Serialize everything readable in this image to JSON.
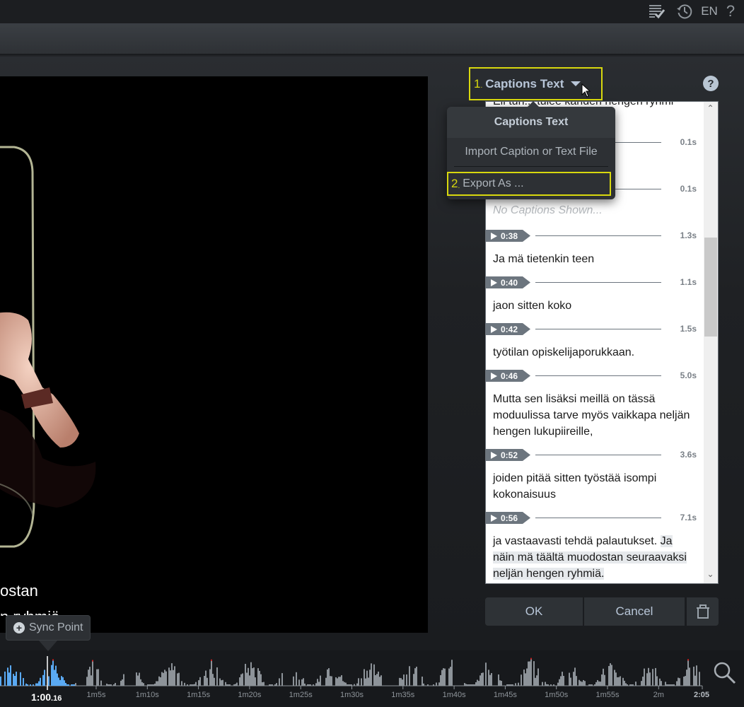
{
  "topbar": {
    "icons": [
      "checklist-icon",
      "history-icon"
    ],
    "language": "EN",
    "help_glyph": "?"
  },
  "video_overlay": {
    "caption_line1": "ostan",
    "caption_line2": "n ryhmiä"
  },
  "caption_panel": {
    "step1_number": "1",
    "selector_label": "Captions Text",
    "help_glyph": "?",
    "clipped_top_text": "Eli tuh... tulee kahden hengen ryhmi",
    "placeholder": "No Captions Shown...",
    "entries": [
      {
        "time": "",
        "duration": "0.1s",
        "text": ""
      },
      {
        "time": "",
        "duration": "0.1s",
        "text": ""
      },
      {
        "time": "0:38",
        "duration": "1.3s",
        "text": "Ja mä tietenkin teen"
      },
      {
        "time": "0:40",
        "duration": "1.1s",
        "text": "jaon sitten koko"
      },
      {
        "time": "0:42",
        "duration": "1.5s",
        "text": "työtilan opiskelijaporukkaan."
      },
      {
        "time": "0:46",
        "duration": "5.0s",
        "text": "Mutta sen lisäksi meillä on tässä moduulissa tarve myös vaikkapa neljän hengen lukupiireille,"
      },
      {
        "time": "0:52",
        "duration": "3.6s",
        "text": "joiden pitää sitten työstää isompi kokonaisuus"
      },
      {
        "time": "0:56",
        "duration": "7.1s",
        "text_plain": "ja vastaavasti tehdä palautukset. ",
        "text_highlight": "Ja näin mä täältä muodostan seuraavaksi neljän hengen ryhmiä."
      }
    ],
    "scroll_position": 0.38
  },
  "dropdown_menu": {
    "title": "Captions Text",
    "items": [
      {
        "label": "Import Caption or Text File"
      },
      {
        "step_number": "2",
        "label": "Export As ..."
      }
    ]
  },
  "dialog_buttons": {
    "ok": "OK",
    "cancel": "Cancel",
    "delete_icon": "trash-icon"
  },
  "sync_point": {
    "label": "Sync Point"
  },
  "timeline": {
    "current_time": "1:00",
    "current_time_fraction": ".16",
    "end_time": "2:05",
    "ticks": [
      "1m5s",
      "1m10s",
      "1m15s",
      "1m20s",
      "1m25s",
      "1m30s",
      "1m35s",
      "1m40s",
      "1m45s",
      "1m50s",
      "1m55s",
      "2m"
    ],
    "colors": {
      "played": "#5aa9f2",
      "unplayed": "#8d9399",
      "peak": "#d02020"
    }
  }
}
